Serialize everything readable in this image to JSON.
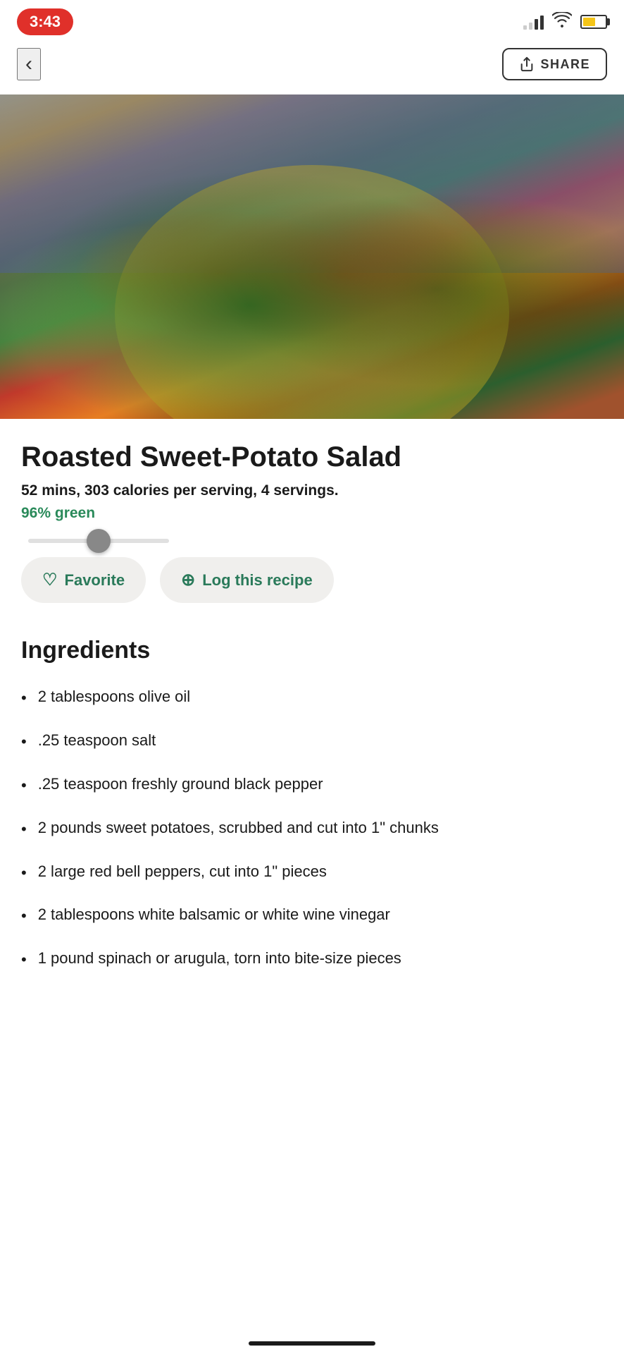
{
  "statusBar": {
    "time": "3:43"
  },
  "navBar": {
    "backLabel": "‹",
    "shareLabel": "SHARE"
  },
  "recipe": {
    "title": "Roasted Sweet-Potato Salad",
    "meta": "52 mins, 303 calories per serving, 4 servings.",
    "greenBadge": "96% green",
    "favoriteLabel": "Favorite",
    "logLabel": "Log this recipe"
  },
  "ingredients": {
    "sectionTitle": "Ingredients",
    "items": [
      "2 tablespoons olive oil",
      ".25 teaspoon salt",
      ".25 teaspoon freshly ground black pepper",
      "2 pounds sweet potatoes, scrubbed and cut into 1\" chunks",
      "2  large red bell peppers, cut into 1\" pieces",
      "2 tablespoons white balsamic or white wine vinegar",
      "1 pound spinach or arugula, torn into bite-size pieces"
    ]
  },
  "icons": {
    "back": "chevron-left",
    "share": "share",
    "heart": "♡",
    "plusCircle": "⊕"
  }
}
